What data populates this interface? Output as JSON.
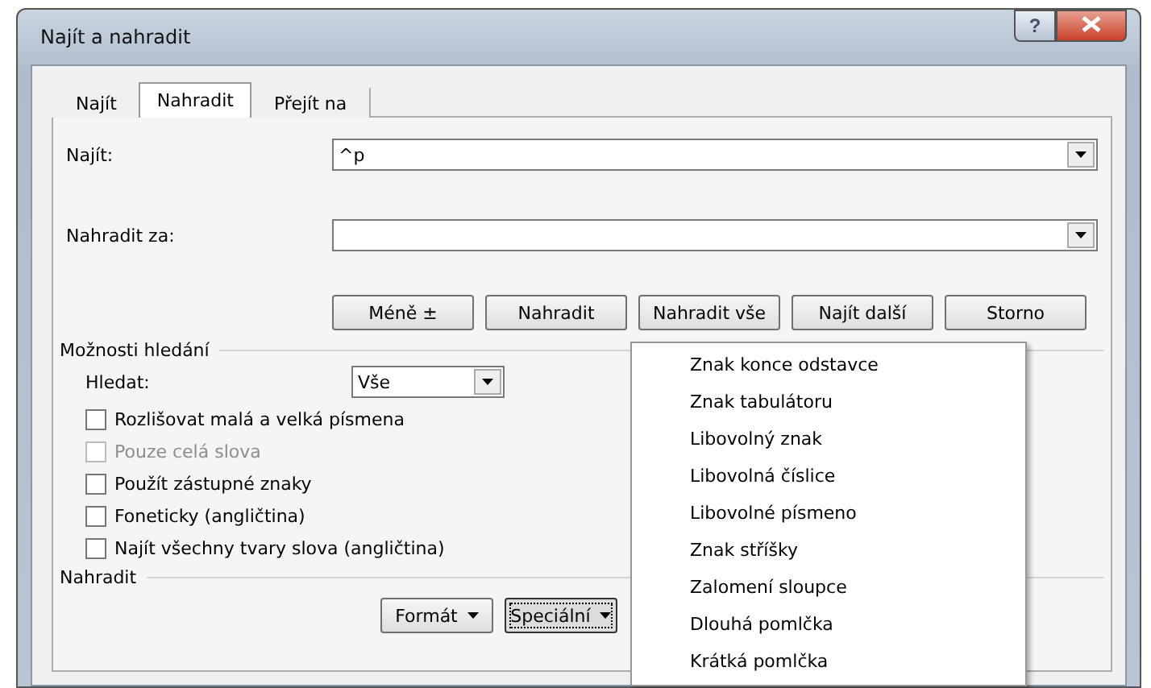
{
  "window": {
    "title": "Najít a nahradit",
    "help_button": "?"
  },
  "tabs": [
    {
      "label": "Najít",
      "selected": false
    },
    {
      "label": "Nahradit",
      "selected": true
    },
    {
      "label": "Přejít na",
      "selected": false
    }
  ],
  "find_field": {
    "label": "Najít:",
    "value": "^p"
  },
  "replace_field": {
    "label": "Nahradit za:"
  },
  "buttons": [
    "Méně ±",
    "Nahradit",
    "Nahradit vše",
    "Najít další",
    "Storno"
  ],
  "search_options": {
    "title": "Možnosti hledání",
    "search_label": "Hledat:",
    "search_value": "Vše",
    "checkboxes": [
      {
        "label": "Rozlišovat malá a velká písmena",
        "checked": false,
        "disabled": false
      },
      {
        "label": "Pouze celá slova",
        "checked": false,
        "disabled": true
      },
      {
        "label": "Použít zástupné znaky",
        "checked": false,
        "disabled": false
      },
      {
        "label": "Foneticky (angličtina)",
        "checked": false,
        "disabled": false
      },
      {
        "label": "Najít všechny tvary slova (angličtina)",
        "checked": false,
        "disabled": false
      }
    ]
  },
  "replace_section": {
    "title": "Nahradit",
    "buttons": [
      {
        "label": "Formát",
        "pressed": false
      },
      {
        "label": "Speciální",
        "pressed": true
      }
    ]
  },
  "special_menu": [
    "Znak konce odstavce",
    "Znak tabulátoru",
    "Libovolný znak",
    "Libovolná číslice",
    "Libovolné písmeno",
    "Znak stříšky",
    "Zalomení sloupce",
    "Dlouhá pomlčka",
    "Krátká pomlčka"
  ]
}
